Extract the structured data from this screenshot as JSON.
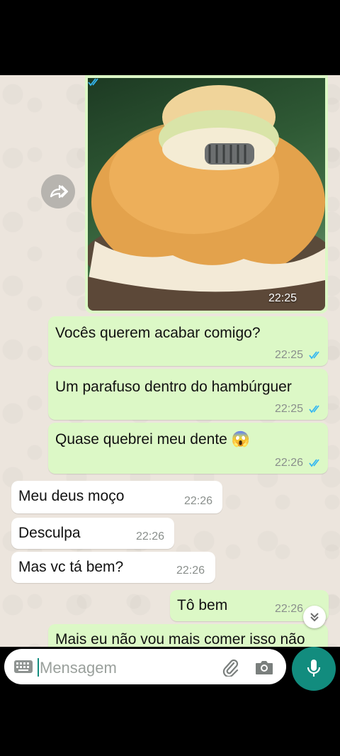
{
  "image_message": {
    "time": "22:25"
  },
  "messages": [
    {
      "direction": "out",
      "text": "Vocês querem acabar comigo?",
      "time": "22:25"
    },
    {
      "direction": "out",
      "text": "Um parafuso dentro do hambúrguer",
      "time": "22:25"
    },
    {
      "direction": "out",
      "text": "Quase quebrei meu dente 😱",
      "time": "22:26"
    },
    {
      "direction": "in",
      "text": "Meu deus moço",
      "time": "22:26"
    },
    {
      "direction": "in",
      "text": "Desculpa",
      "time": "22:26"
    },
    {
      "direction": "in",
      "text": "Mas vc tá bem?",
      "time": "22:26"
    },
    {
      "direction": "out",
      "text": "Tô bem",
      "time": "22:26"
    },
    {
      "direction": "out",
      "text": "Mais eu não vou mais comer isso não",
      "time": ""
    }
  ],
  "composer": {
    "placeholder": "Mensagem"
  },
  "icons": {
    "forward": "forward-icon",
    "scroll": "chevron-double-down-icon",
    "keyboard": "keyboard-icon",
    "attach": "paperclip-icon",
    "camera": "camera-icon",
    "mic": "microphone-icon"
  },
  "colors": {
    "outgoing_bubble": "#dcf8c6",
    "incoming_bubble": "#ffffff",
    "background": "#ece5dd",
    "accent": "#128c7e",
    "read_ticks": "#34b7f1"
  }
}
